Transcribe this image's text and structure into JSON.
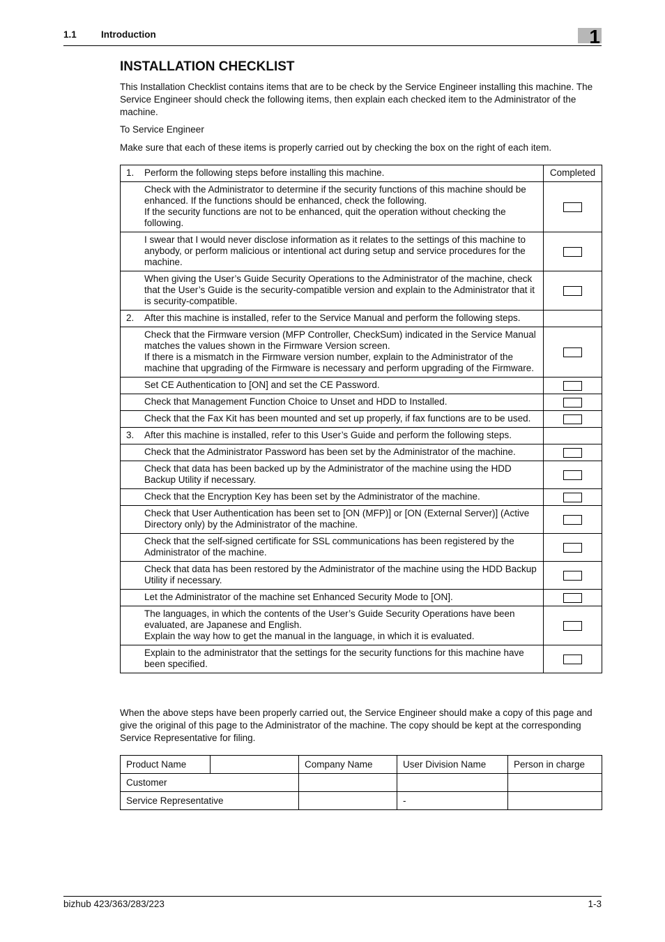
{
  "header": {
    "section_number": "1.1",
    "section_title": "Introduction",
    "chapter_tab": "1"
  },
  "title": "INSTALLATION CHECKLIST",
  "intro": {
    "paragraph1": "This Installation Checklist contains items that are to be check by the Service Engineer installing this machine. The Service Engineer should check the following items, then explain each checked item to the Administrator of the machine.",
    "paragraph2": "To Service Engineer",
    "paragraph3": "Make sure that each of these items is properly carried out by checking the box on the right of each item."
  },
  "checklist": {
    "completed_header": "Completed",
    "sections": [
      {
        "number": "1.",
        "heading": "Perform the following steps before installing this machine.",
        "items": [
          {
            "text": "Check with the Administrator to determine if the security functions of this machine should be enhanced. If the functions should be enhanced, check the following.\nIf the security functions are not to be enhanced, quit the operation without checking the following.",
            "checked": false
          },
          {
            "text": "I swear that I would never disclose information as it relates to the settings of this machine to anybody, or perform malicious or intentional act during setup and service procedures for the machine.",
            "checked": false
          },
          {
            "text": "When giving the User’s Guide Security Operations to the Administrator of the machine, check that the User’s Guide is the security-compatible version and explain to the Administrator that it is security-compatible.",
            "checked": false
          }
        ]
      },
      {
        "number": "2.",
        "heading": "After this machine is installed, refer to the Service Manual and perform the following steps.",
        "items": [
          {
            "text": "Check that the Firmware version (MFP Controller, CheckSum) indicated in the Service Manual matches the values shown in the Firmware Version screen.\nIf there is a mismatch in the Firmware version number, explain to the Administrator of the machine that upgrading of the Firmware is necessary and perform upgrading of the Firmware.",
            "checked": false
          },
          {
            "text": "Set CE Authentication to [ON] and set the CE Password.",
            "checked": false
          },
          {
            "text": "Check that Management Function Choice to Unset and HDD to Installed.",
            "checked": false
          },
          {
            "text": "Check that the Fax Kit has been mounted and set up properly, if fax functions are to be used.",
            "checked": false
          }
        ]
      },
      {
        "number": "3.",
        "heading": "After this machine is installed, refer to this User’s Guide and perform the following steps.",
        "items": [
          {
            "text": "Check that the Administrator Password has been set by the Administrator of the machine.",
            "checked": false
          },
          {
            "text": "Check that data has been backed up by the Administrator of the machine using the HDD Backup Utility if necessary.",
            "checked": false
          },
          {
            "text": "Check that the Encryption Key has been set by the Administrator of the machine.",
            "checked": false
          },
          {
            "text": "Check that User Authentication has been set to [ON (MFP)] or [ON (External Server)] (Active Directory only) by the Administrator of the machine.",
            "checked": false
          },
          {
            "text": "Check that the self-signed certificate for SSL communications has been registered by the Administrator of the machine.",
            "checked": false
          },
          {
            "text": "Check that data has been restored by the Administrator of the machine using the HDD Backup Utility if necessary.",
            "checked": false
          },
          {
            "text": "Let the Administrator of the machine set Enhanced Security Mode to [ON].",
            "checked": false
          },
          {
            "text": "The languages, in which the contents of the User’s Guide Security Operations have been evaluated, are Japanese and English.\nExplain the way how to get the manual in the language, in which it is evaluated.",
            "checked": false
          },
          {
            "text": "Explain to the administrator that the settings for the security functions for this machine have been specified.",
            "checked": false
          }
        ]
      }
    ]
  },
  "closing_paragraph": "When the above steps have been properly carried out, the Service Engineer should make a copy of this page and give the original of this page to the Administrator of the machine. The copy should be kept at the corresponding Service Representative for filing.",
  "info_table": {
    "headers": {
      "product_name": "Product Name",
      "product_value": "",
      "company_name": "Company Name",
      "user_division_name": "User Division Name",
      "person_in_charge": "Person in charge"
    },
    "rows": [
      {
        "label": "Customer",
        "company": "",
        "division": "",
        "person": ""
      },
      {
        "label": "Service Representative",
        "company": "",
        "division": "-",
        "person": ""
      }
    ]
  },
  "footer": {
    "model": "bizhub 423/363/283/223",
    "page": "1-3"
  }
}
